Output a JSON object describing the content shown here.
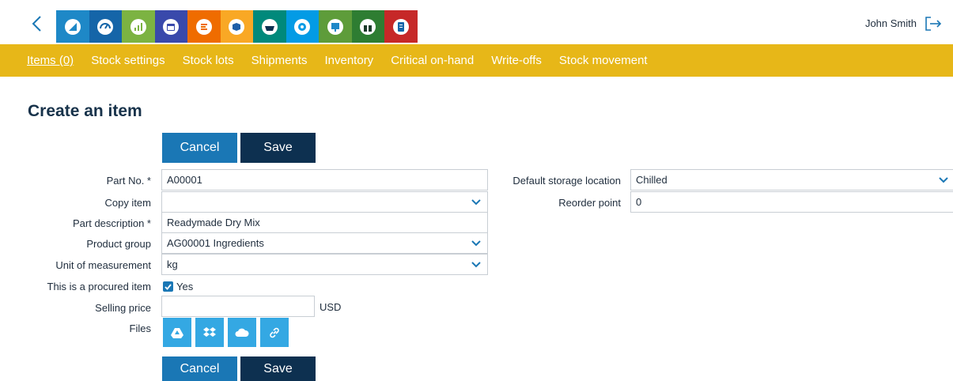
{
  "header": {
    "user_name": "John Smith",
    "apps": [
      {
        "name": "app-1",
        "color": "#1e88c7"
      },
      {
        "name": "app-2",
        "color": "#1565a8"
      },
      {
        "name": "app-3",
        "color": "#7cb342"
      },
      {
        "name": "app-4",
        "color": "#3949ab"
      },
      {
        "name": "app-5",
        "color": "#ef6c00"
      },
      {
        "name": "app-6",
        "color": "#f9a825"
      },
      {
        "name": "app-7",
        "color": "#00897b"
      },
      {
        "name": "app-8",
        "color": "#039be5"
      },
      {
        "name": "app-9",
        "color": "#5e9c3a"
      },
      {
        "name": "app-10",
        "color": "#2e7d32"
      },
      {
        "name": "app-11",
        "color": "#c62828"
      }
    ]
  },
  "nav": {
    "items": [
      "Items (0)",
      "Stock settings",
      "Stock lots",
      "Shipments",
      "Inventory",
      "Critical on-hand",
      "Write-offs",
      "Stock movement"
    ],
    "accent": "#e7b718"
  },
  "page": {
    "title": "Create an item"
  },
  "buttons": {
    "cancel": "Cancel",
    "save": "Save"
  },
  "form": {
    "part_no": {
      "label": "Part No. *",
      "value": "A00001"
    },
    "copy_item": {
      "label": "Copy item",
      "value": ""
    },
    "part_description": {
      "label": "Part description *",
      "value": "Readymade Dry Mix"
    },
    "product_group": {
      "label": "Product group",
      "value": "AG00001 Ingredients"
    },
    "unit": {
      "label": "Unit of measurement",
      "value": "kg"
    },
    "procured": {
      "label": "This is a procured item",
      "value": "Yes",
      "checked": true
    },
    "selling_price": {
      "label": "Selling price",
      "value": "",
      "currency": "USD"
    },
    "files": {
      "label": "Files"
    },
    "default_storage": {
      "label": "Default storage location",
      "value": "Chilled"
    },
    "reorder_point": {
      "label": "Reorder point",
      "value": "0"
    }
  }
}
